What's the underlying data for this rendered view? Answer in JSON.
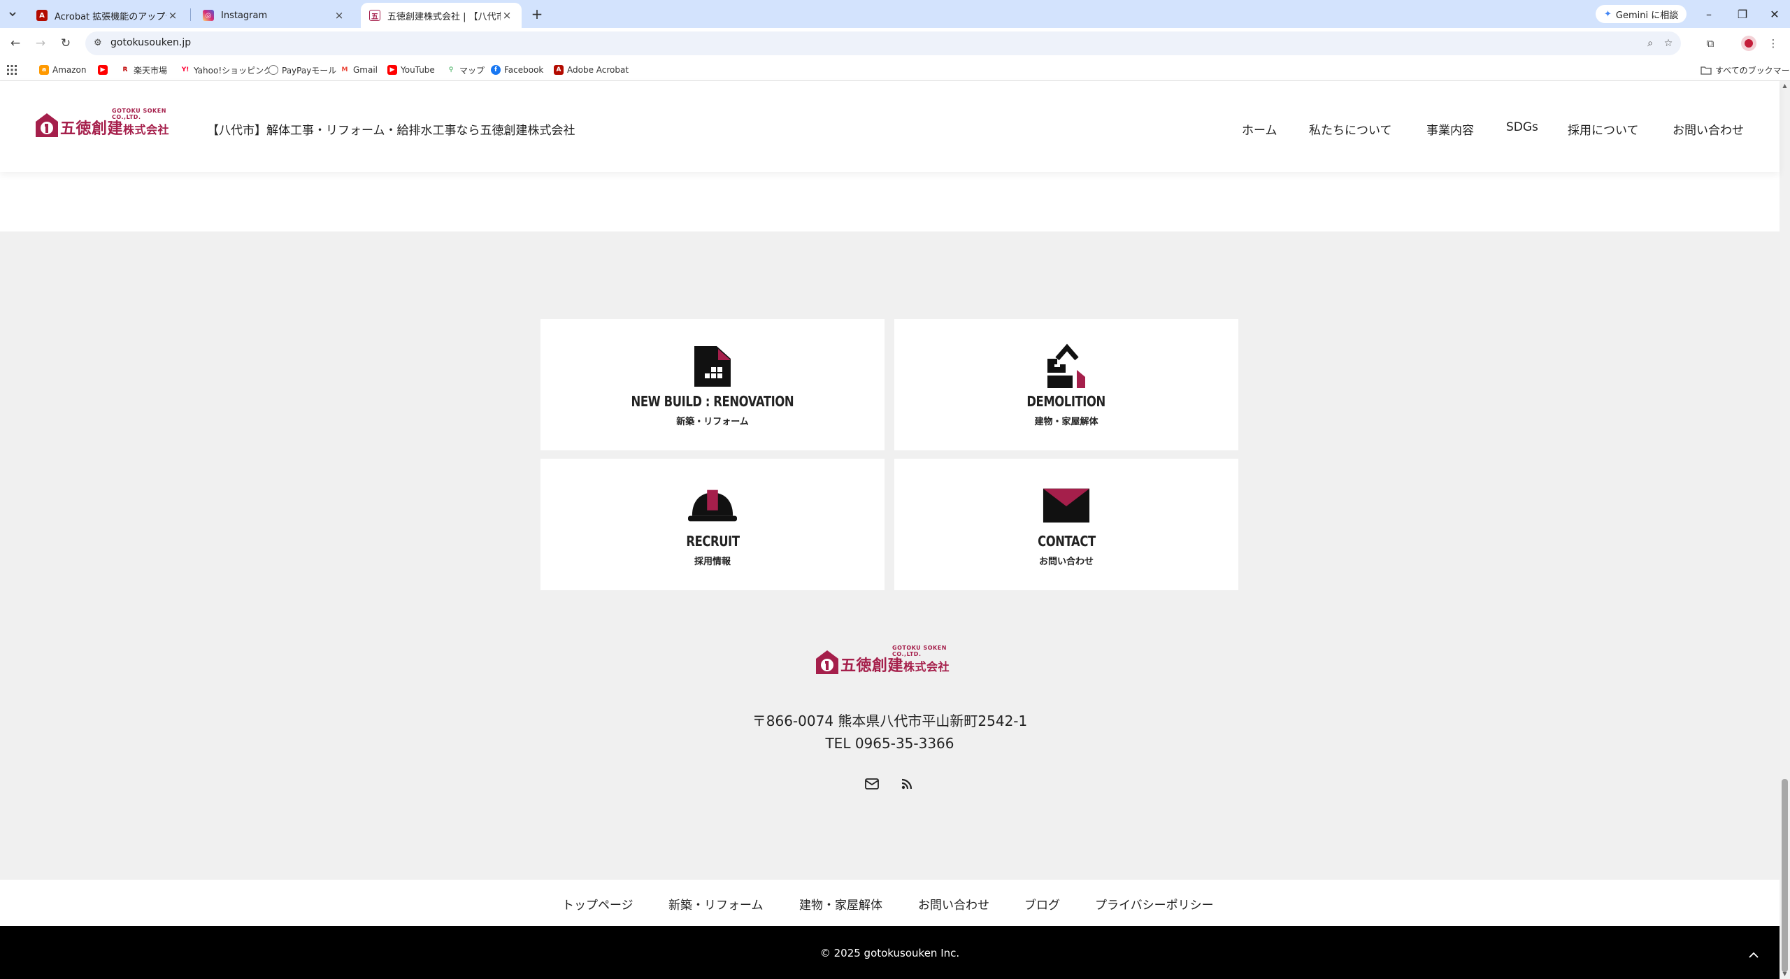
{
  "browser": {
    "tabs": [
      {
        "title": "Acrobat 拡張機能のアップデート",
        "favicon": "acrobat-icon",
        "color": "#b30b00"
      },
      {
        "title": "Instagram",
        "favicon": "instagram-icon",
        "color": "#d62976"
      },
      {
        "title": "五徳創建株式会社 | 【八代市】解",
        "favicon": "gotoku-icon",
        "color": "#a51f4b"
      }
    ],
    "gemini_label": "Gemini に相談",
    "url": "gotokusouken.jp",
    "bookmarks": [
      {
        "label": "Amazon",
        "icon": "amazon-icon",
        "color": "#ff9900"
      },
      {
        "label": "",
        "icon": "youtube-icon",
        "color": "#ff0000"
      },
      {
        "label": "楽天市場",
        "icon": "rakuten-icon",
        "color": "#bf0000"
      },
      {
        "label": "Yahoo!ショッピング",
        "icon": "yahoo-icon",
        "color": "#ff0033"
      },
      {
        "label": "PayPayモール",
        "icon": "globe-icon",
        "color": "#555555"
      },
      {
        "label": "Gmail",
        "icon": "gmail-icon",
        "color": "#ea4335"
      },
      {
        "label": "YouTube",
        "icon": "youtube-icon",
        "color": "#ff0000"
      },
      {
        "label": "マップ",
        "icon": "maps-icon",
        "color": "#34a853"
      },
      {
        "label": "Facebook",
        "icon": "facebook-icon",
        "color": "#1877f2"
      },
      {
        "label": "Adobe Acrobat",
        "icon": "acrobat-icon",
        "color": "#b30b00"
      }
    ],
    "all_bookmarks_label": "すべてのブックマーク"
  },
  "site": {
    "brand_color": "#a51f4b",
    "logo_text": "五徳創建",
    "logo_suffix": "株式会社",
    "logo_en": "GOTOKU SOKEN CO.,LTD.",
    "tagline": "【八代市】解体工事・リフォーム・給排水工事なら五徳創建株式会社",
    "nav": [
      "ホーム",
      "私たちについて",
      "事業内容",
      "SDGs",
      "採用について",
      "お問い合わせ"
    ],
    "cards": [
      {
        "en": "NEW BUILD : RENOVATION",
        "jp": "新築・リフォーム",
        "icon": "building-icon"
      },
      {
        "en": "DEMOLITION",
        "jp": "建物・家屋解体",
        "icon": "demolition-icon"
      },
      {
        "en": "RECRUIT",
        "jp": "採用情報",
        "icon": "helmet-icon"
      },
      {
        "en": "CONTACT",
        "jp": "お問い合わせ",
        "icon": "envelope-icon"
      }
    ],
    "address": "〒866-0074 熊本県八代市平山新町2542-1",
    "tel": "TEL 0965-35-3366",
    "social": [
      "mail-icon",
      "rss-icon"
    ],
    "footer_links": [
      "トップページ",
      "新築・リフォーム",
      "建物・家屋解体",
      "お問い合わせ",
      "ブログ",
      "プライバシーポリシー"
    ],
    "copyright": "© 2025 gotokusouken Inc."
  }
}
